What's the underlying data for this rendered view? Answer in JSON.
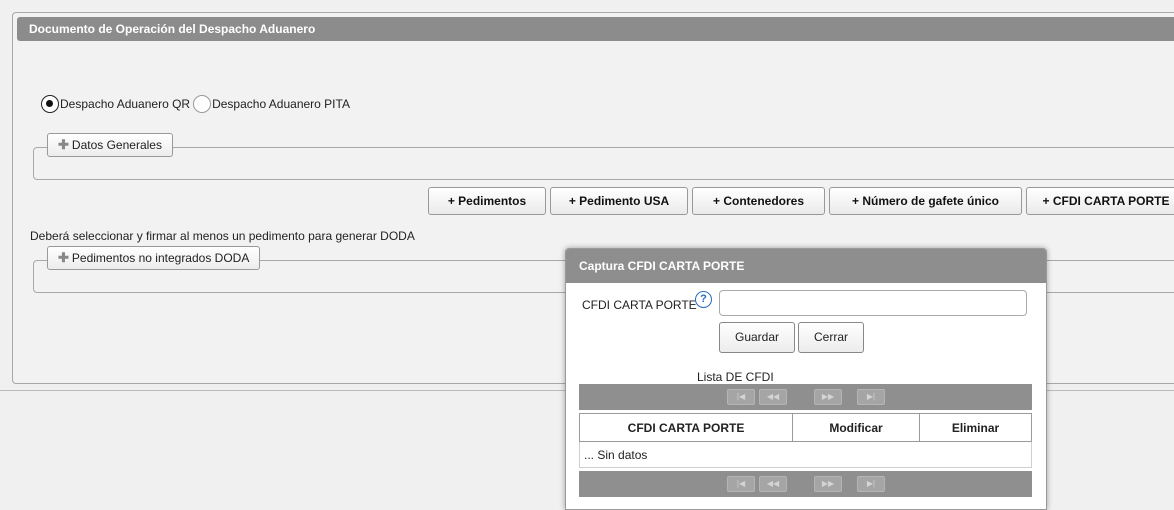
{
  "panel": {
    "title": "Documento de Operación del Despacho Aduanero"
  },
  "radios": [
    {
      "label": "Despacho Aduanero QR",
      "checked": true
    },
    {
      "label": "Despacho Aduanero PITA",
      "checked": false
    }
  ],
  "sections": {
    "datos_generales": "Datos Generales",
    "pedimentos_no_integrados": "Pedimentos no integrados DODA"
  },
  "tabs": [
    "+ Pedimentos",
    "+ Pedimento USA",
    "+ Contenedores",
    "+ Número de gafete único",
    "+ CFDI CARTA PORTE"
  ],
  "notice": "Deberá seleccionar y firmar al menos un pedimento para generar DODA",
  "dialog": {
    "title": "Captura CFDI CARTA PORTE",
    "field_label": "CFDI CARTA PORTE",
    "help_icon": "?",
    "input_value": "",
    "save_label": "Guardar",
    "close_label": "Cerrar",
    "list_title": "Lista DE CFDI",
    "columns": [
      "CFDI CARTA PORTE",
      "Modificar",
      "Eliminar"
    ],
    "empty_text": "... Sin datos",
    "pager": {
      "first": "|◀",
      "prev": "◀◀",
      "next": "▶▶",
      "last": "▶|"
    }
  },
  "icons": {
    "plus": "plus-icon",
    "help": "help-icon"
  },
  "colors": {
    "header": "#8c8c8c",
    "help": "#2a6bbf"
  }
}
